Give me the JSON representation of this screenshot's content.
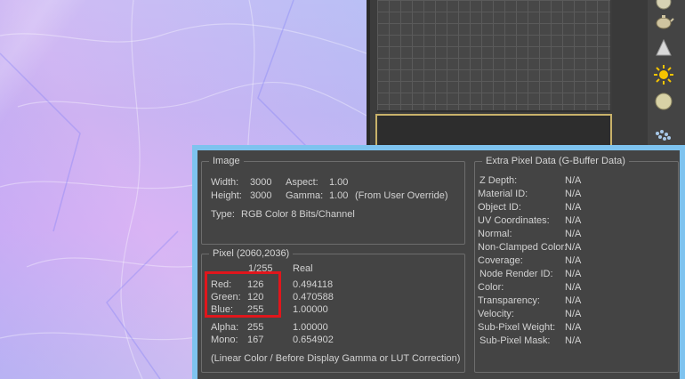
{
  "image_section": {
    "title": "Image",
    "width_label": "Width:",
    "width_value": "3000",
    "height_label": "Height:",
    "height_value": "3000",
    "aspect_label": "Aspect:",
    "aspect_value": "1.00",
    "gamma_label": "Gamma:",
    "gamma_value": "1.00",
    "gamma_note": "(From User Override)",
    "type_label": "Type:",
    "type_value": "RGB Color 8 Bits/Channel"
  },
  "pixel_section": {
    "title": "Pixel (2060,2036)",
    "col_255": "1/255",
    "col_real": "Real",
    "rows": [
      {
        "label": "Red:",
        "v255": "126",
        "real": "0.494118"
      },
      {
        "label": "Green:",
        "v255": "120",
        "real": "0.470588"
      },
      {
        "label": "Blue:",
        "v255": "255",
        "real": "1.00000"
      },
      {
        "label": "Alpha:",
        "v255": "255",
        "real": "1.00000"
      },
      {
        "label": "Mono:",
        "v255": "167",
        "real": "0.654902"
      }
    ],
    "note": "(Linear Color / Before Display Gamma or LUT Correction)"
  },
  "extra_section": {
    "title": "Extra Pixel Data (G-Buffer Data)",
    "rows": [
      {
        "label": "Z Depth:",
        "value": "N/A"
      },
      {
        "label": "Material ID:",
        "value": "N/A"
      },
      {
        "label": "Object ID:",
        "value": "N/A"
      },
      {
        "label": "UV Coordinates:",
        "value": "N/A"
      },
      {
        "label": "Normal:",
        "value": "N/A"
      },
      {
        "label": "Non-Clamped Color:",
        "value": "N/A"
      },
      {
        "label": "Coverage:",
        "value": "N/A"
      },
      {
        "label": "Node Render ID:",
        "value": "N/A"
      },
      {
        "label": "Color:",
        "value": "N/A"
      },
      {
        "label": "Transparency:",
        "value": "N/A"
      },
      {
        "label": "Velocity:",
        "value": "N/A"
      },
      {
        "label": "Sub-Pixel Weight:",
        "value": "N/A"
      },
      {
        "label": "Sub-Pixel Mask:",
        "value": "N/A"
      }
    ]
  },
  "colors": {
    "highlight": "#e0161c",
    "dialog_border": "#7ec3ef",
    "panel_bg": "#444444"
  },
  "toolbar_icons": [
    "light-icon",
    "teapot-icon",
    "cone-icon",
    "sun-icon",
    "sphere-icon",
    "particles-icon"
  ]
}
